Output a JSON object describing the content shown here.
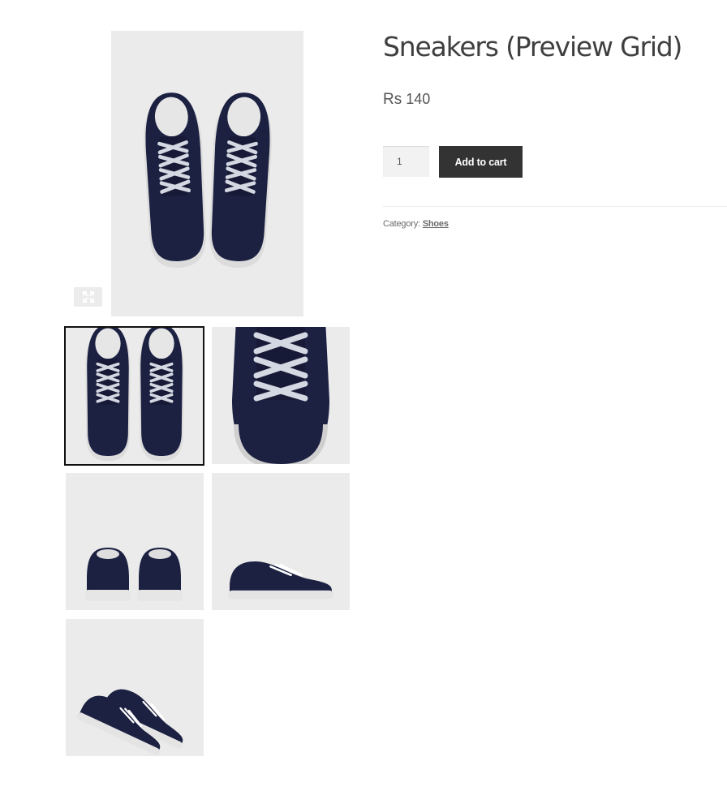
{
  "product": {
    "title": "Sneakers (Preview Grid)",
    "currency": "Rs",
    "price": "140",
    "quantity": "1",
    "add_to_cart_label": "Add to cart",
    "category_label": "Category:",
    "category_link": "Shoes"
  },
  "gallery": {
    "zoom_icon": "expand-icon",
    "main_image": "sneakers-top-view",
    "thumbnails": [
      {
        "view": "top-view",
        "active": true
      },
      {
        "view": "laces-closeup",
        "active": false
      },
      {
        "view": "back-view",
        "active": false
      },
      {
        "view": "side-view",
        "active": false
      },
      {
        "view": "angled-pair-view",
        "active": false
      }
    ]
  },
  "colors": {
    "shoe_navy": "#1c2142",
    "image_background": "#ebebeb",
    "button_background": "#333333"
  }
}
